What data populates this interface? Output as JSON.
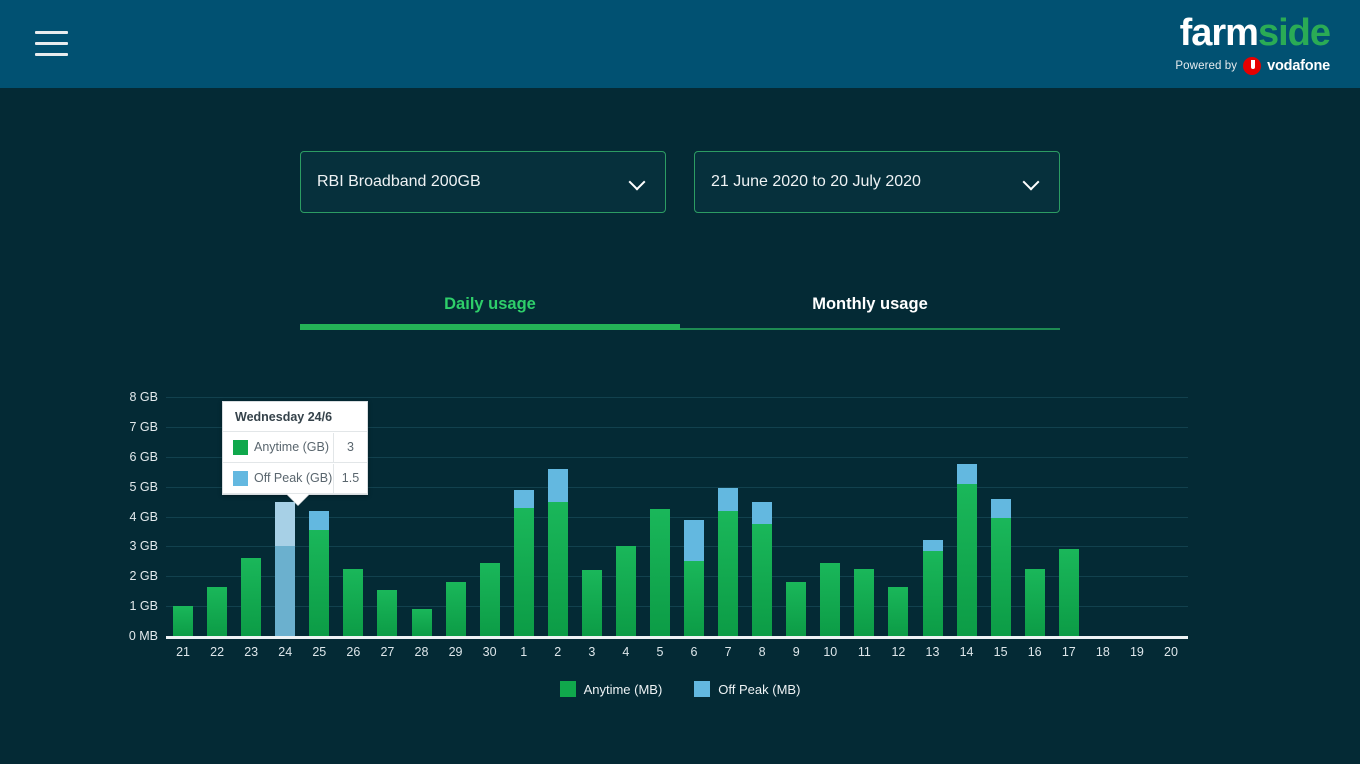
{
  "header": {
    "menu_icon": "hamburger-menu-icon",
    "brand_first": "farm",
    "brand_second": "side",
    "powered_by": "Powered by",
    "vodafone_word": "vodafone",
    "bg_color": "#015172"
  },
  "filters": {
    "plan": {
      "value": "RBI Broadband 200GB",
      "chevron": "chevron-down-icon"
    },
    "period": {
      "value": "21 June 2020 to 20 July 2020",
      "chevron": "chevron-down-icon"
    },
    "border_color": "#2c9c63"
  },
  "tabs": [
    {
      "label": "Daily usage",
      "active": true,
      "color": "#2ecf6a"
    },
    {
      "label": "Monthly usage",
      "active": false,
      "color": "#ffffff"
    }
  ],
  "legend": [
    {
      "label": "Anytime (MB)",
      "color": "#10a84c"
    },
    {
      "label": "Off Peak (MB)",
      "color": "#63b8e0"
    }
  ],
  "tooltip": {
    "title": "Wednesday 24/6",
    "rows": [
      {
        "label": "Anytime (GB)",
        "value": "3",
        "color": "#10a84c"
      },
      {
        "label": "Off Peak (GB)",
        "value": "1.5",
        "color": "#63b8e0"
      }
    ]
  },
  "chart_data": {
    "type": "bar",
    "title": "Daily usage",
    "xlabel": "",
    "ylabel": "",
    "stacked": true,
    "grid": true,
    "legend_position": "bottom",
    "ylim": [
      0,
      8
    ],
    "ytick_labels": [
      "8 GB",
      "7 GB",
      "6 GB",
      "5 GB",
      "4 GB",
      "3 GB",
      "2 GB",
      "1 GB",
      "0 MB"
    ],
    "ytick_values": [
      8,
      7,
      6,
      5,
      4,
      3,
      2,
      1,
      0
    ],
    "categories": [
      "21",
      "22",
      "23",
      "24",
      "25",
      "26",
      "27",
      "28",
      "29",
      "30",
      "1",
      "2",
      "3",
      "4",
      "5",
      "6",
      "7",
      "8",
      "9",
      "10",
      "11",
      "12",
      "13",
      "14",
      "15",
      "16",
      "17",
      "18",
      "19",
      "20"
    ],
    "highlighted_category": "24",
    "series": [
      {
        "name": "Anytime (GB)",
        "color": "#10a84c",
        "highlight_color": "#6bb0ce",
        "values": [
          1.0,
          1.65,
          2.6,
          3.0,
          3.55,
          2.25,
          1.55,
          0.9,
          1.8,
          2.45,
          4.3,
          4.5,
          2.2,
          3.0,
          4.25,
          2.5,
          4.2,
          3.75,
          1.8,
          2.45,
          2.25,
          1.65,
          2.85,
          5.1,
          3.95,
          2.25,
          2.9,
          0,
          0,
          0
        ]
      },
      {
        "name": "Off Peak (GB)",
        "color": "#63b8e0",
        "highlight_color": "#a7d0e6",
        "values": [
          0,
          0,
          0,
          1.5,
          0.65,
          0,
          0,
          0,
          0,
          0,
          0.6,
          1.1,
          0,
          0,
          0,
          1.4,
          0.75,
          0.75,
          0,
          0,
          0,
          0,
          0.35,
          0.65,
          0.65,
          0,
          0,
          0,
          0,
          0
        ]
      }
    ]
  }
}
